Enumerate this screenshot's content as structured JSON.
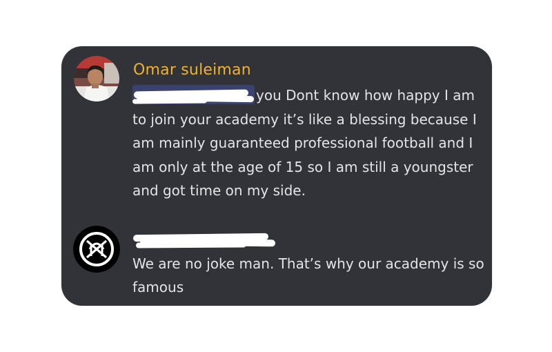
{
  "messages": [
    {
      "username": "Omar suleiman",
      "username_color": "#f0b232",
      "mention_redacted": true,
      "text": "you Dont know how happy I am to join your academy it’s like a blessing because I am mainly guaranteed professional football and I am only at the age of 15 so I am still a youngster and got time on my side."
    },
    {
      "username_redacted": true,
      "text": "We are no joke man. That’s why our academy is so famous"
    }
  ],
  "colors": {
    "card_background": "#313338",
    "text": "#e3e5e8",
    "mention_background": "#3c4270",
    "redaction": "#ffffff"
  }
}
